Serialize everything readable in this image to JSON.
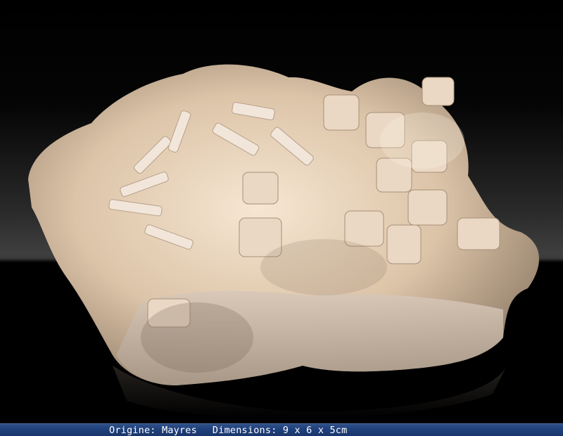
{
  "caption": {
    "origin": "Origine: Mayres",
    "dimensions": "Dimensions: 9 x 6 x 5cm"
  },
  "photo": {
    "subject": "mineral-specimen",
    "background_color": "#000000",
    "caption_bar_color": "#1f3f7a"
  }
}
